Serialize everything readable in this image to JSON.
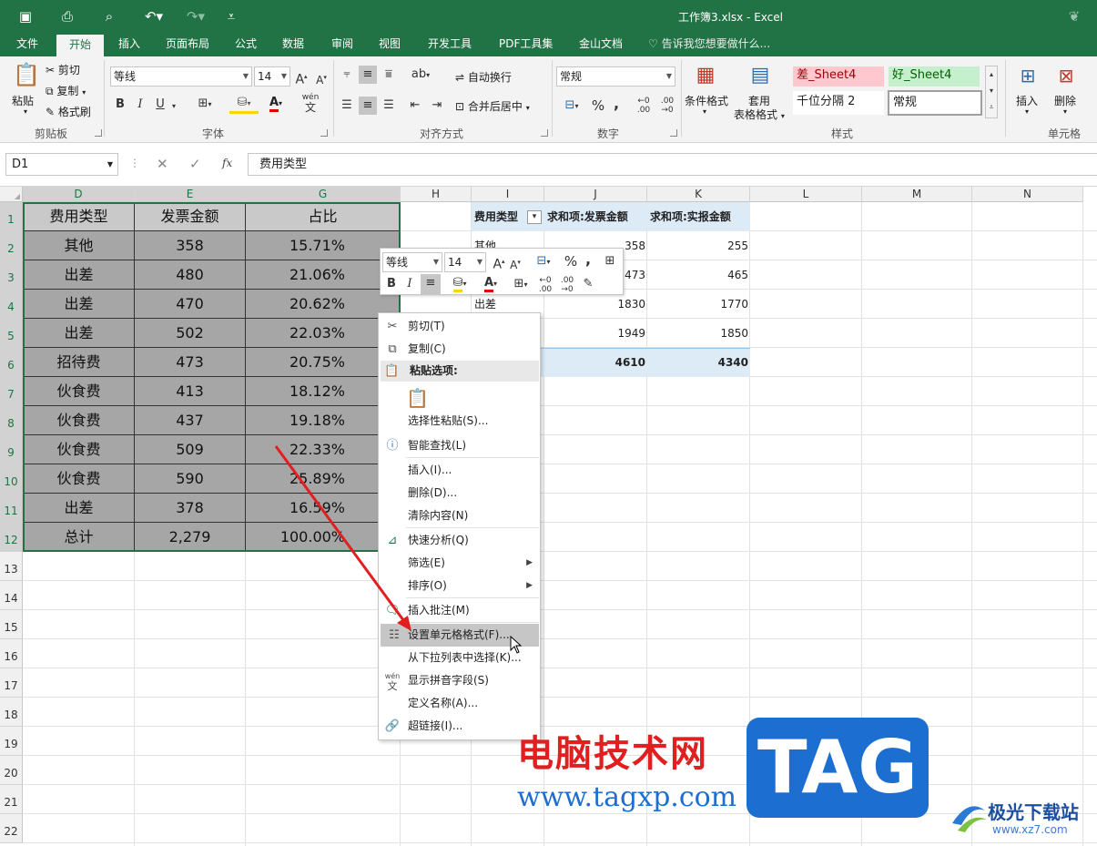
{
  "window": {
    "title": "工作簿3.xlsx - Excel"
  },
  "ribbon": {
    "tabs": [
      "文件",
      "开始",
      "插入",
      "页面布局",
      "公式",
      "数据",
      "审阅",
      "视图",
      "开发工具",
      "PDF工具集",
      "金山文档"
    ],
    "tell_me": "告诉我您想要做什么...",
    "clipboard": {
      "paste": "粘贴",
      "cut": "剪切",
      "copy": "复制",
      "format_painter": "格式刷",
      "label": "剪贴板"
    },
    "font": {
      "name": "等线",
      "size": "14",
      "bold": "B",
      "italic": "I",
      "underline": "U",
      "label": "字体",
      "wen": "wén",
      "wen_char": "文"
    },
    "align": {
      "wrap": "自动换行",
      "merge": "合并后居中",
      "label": "对齐方式"
    },
    "number": {
      "format": "常规",
      "percent": "%",
      "comma": ",",
      "label": "数字"
    },
    "styles": {
      "cond": "条件格式",
      "table1": "套用",
      "table2": "表格格式",
      "bad": "差_Sheet4",
      "good": "好_Sheet4",
      "thousand": "千位分隔 2",
      "normal": "常规",
      "label": "样式"
    },
    "cells": {
      "insert": "插入",
      "delete": "删除",
      "label": "单元格"
    }
  },
  "formula": {
    "namebox": "D1",
    "fx": "fx",
    "content": "费用类型"
  },
  "columns": [
    "D",
    "E",
    "G",
    "H",
    "I",
    "J",
    "K",
    "L",
    "M",
    "N"
  ],
  "rows": [
    "1",
    "2",
    "3",
    "4",
    "5",
    "6",
    "7",
    "8",
    "9",
    "10",
    "11",
    "12",
    "13",
    "14",
    "15",
    "16",
    "17",
    "18",
    "19",
    "20",
    "21",
    "22"
  ],
  "table": {
    "headers": [
      "费用类型",
      "发票金额",
      "占比"
    ],
    "rows": [
      [
        "其他",
        "358",
        "15.71%"
      ],
      [
        "出差",
        "480",
        "21.06%"
      ],
      [
        "出差",
        "470",
        "20.62%"
      ],
      [
        "出差",
        "502",
        "22.03%"
      ],
      [
        "招待费",
        "473",
        "20.75%"
      ],
      [
        "伙食费",
        "413",
        "18.12%"
      ],
      [
        "伙食费",
        "437",
        "19.18%"
      ],
      [
        "伙食费",
        "509",
        "22.33%"
      ],
      [
        "伙食费",
        "590",
        "25.89%"
      ],
      [
        "出差",
        "378",
        "16.59%"
      ],
      [
        "总计",
        "2,279",
        "100.00%"
      ]
    ]
  },
  "pivot": {
    "headers": [
      "费用类型",
      "求和项:发票金额",
      "求和项:实报金额"
    ],
    "rows": [
      [
        "其他",
        "358",
        "255"
      ],
      [
        "",
        "473",
        "465"
      ],
      [
        "出差",
        "1830",
        "1770"
      ],
      [
        "",
        "1949",
        "1850"
      ],
      [
        "",
        "4610",
        "4340"
      ]
    ]
  },
  "minitoolbar": {
    "font": "等线",
    "size": "14",
    "bold": "B",
    "italic": "I",
    "percent": "%",
    "comma": ","
  },
  "context_menu": {
    "cut": "剪切(T)",
    "copy": "复制(C)",
    "paste_options": "粘贴选项:",
    "paste_special": "选择性粘贴(S)...",
    "smart_lookup": "智能查找(L)",
    "insert": "插入(I)...",
    "delete": "删除(D)...",
    "clear": "清除内容(N)",
    "quick_analysis": "快速分析(Q)",
    "filter": "筛选(E)",
    "sort": "排序(O)",
    "comment": "插入批注(M)",
    "format_cells": "设置单元格格式(F)...",
    "pick_list": "从下拉列表中选择(K)...",
    "phonetic": "显示拼音字段(S)",
    "define_name": "定义名称(A)...",
    "hyperlink": "超链接(I)..."
  },
  "watermark": {
    "cn": "电脑技术网",
    "url": "www.tagxp.com",
    "tag": "TAG",
    "site": "极光下载站",
    "site_url": "www.xz7.com"
  },
  "colors": {
    "excel_green": "#217346",
    "selection_gray": "#a6a6a6",
    "bad_bg": "#ffc7ce",
    "good_bg": "#c6efce"
  }
}
